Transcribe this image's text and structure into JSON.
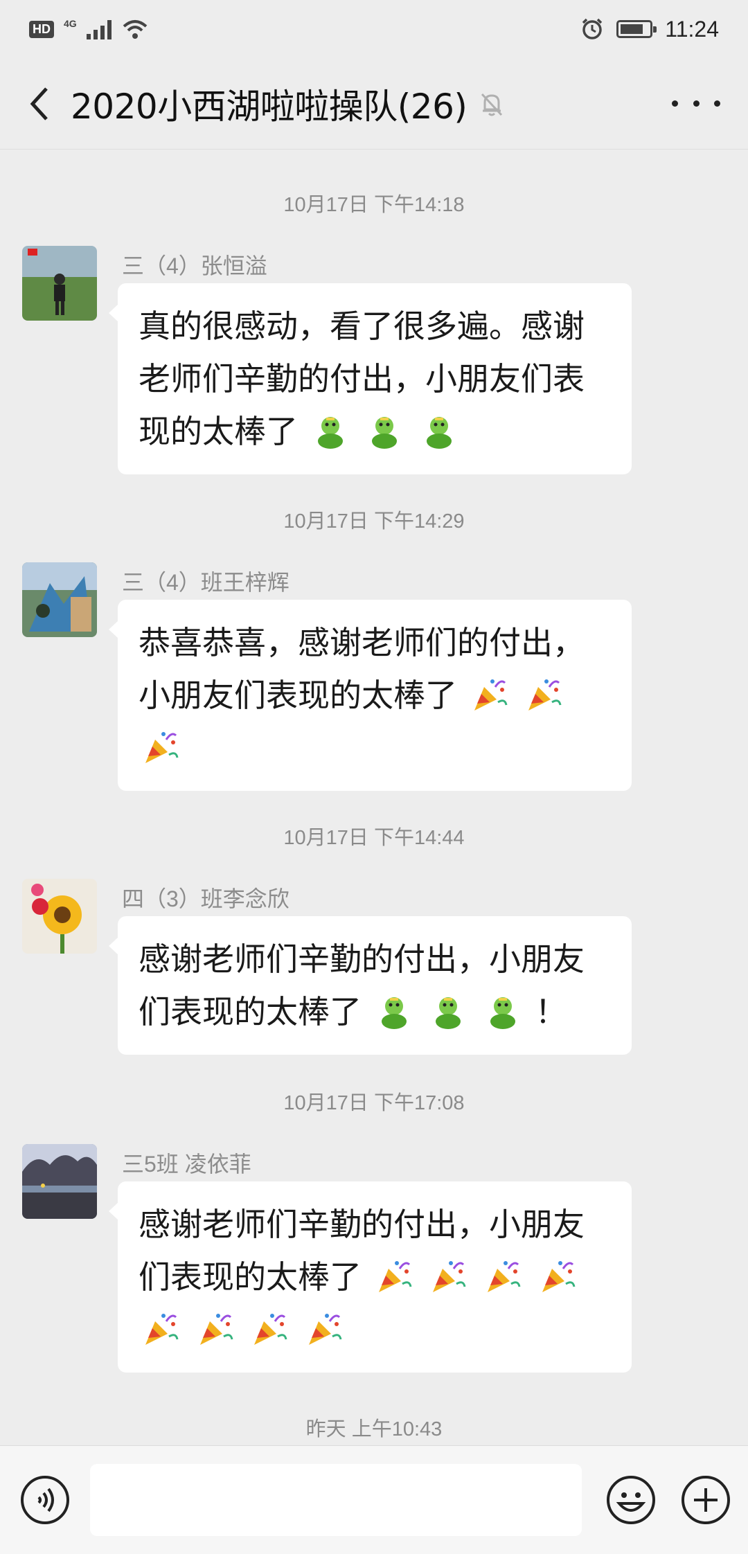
{
  "status_bar": {
    "hd": "HD",
    "network": "4G",
    "time": "11:24",
    "icons": [
      "signal-icon",
      "wifi-icon",
      "alarm-icon",
      "battery-icon"
    ]
  },
  "header": {
    "title": "2020小西湖啦啦操队(26)",
    "icons": [
      "back-icon",
      "mute-bell-icon",
      "more-icon"
    ]
  },
  "messages": [
    {
      "timestamp": "10月17日 下午14:18",
      "sender": "三（4）张恒溢",
      "text": "真的很感动，看了很多遍。感谢老师们辛勤的付出，小朋友们表现的太棒了",
      "emoji": "thumbs-up-emoji",
      "emoji_count": 3
    },
    {
      "timestamp": "10月17日 下午14:29",
      "sender": "三（4）班王梓辉",
      "text": "恭喜恭喜，感谢老师们的付出，小朋友们表现的太棒了",
      "emoji": "party-popper-emoji",
      "emoji_count": 3
    },
    {
      "timestamp": "10月17日 下午14:44",
      "sender": "四（3）班李念欣",
      "text": "感谢老师们辛勤的付出，小朋友们表现的太棒了",
      "emoji": "thumbs-up-emoji",
      "emoji_count": 3,
      "suffix": "！"
    },
    {
      "timestamp": "10月17日 下午17:08",
      "sender": "三5班 凌依菲",
      "text": "感谢老师们辛勤的付出，小朋友们表现的太棒了",
      "emoji": "party-popper-emoji",
      "emoji_count": 8
    }
  ],
  "last_timestamp": "昨天 上午10:43",
  "input_bar": {
    "value": "",
    "placeholder": "",
    "icons": [
      "voice-icon",
      "emoji-icon",
      "plus-icon"
    ]
  },
  "colors": {
    "background": "#ededed",
    "bubble": "#ffffff",
    "timestamp": "#8a8a8a",
    "sender": "#8c8c8c"
  }
}
